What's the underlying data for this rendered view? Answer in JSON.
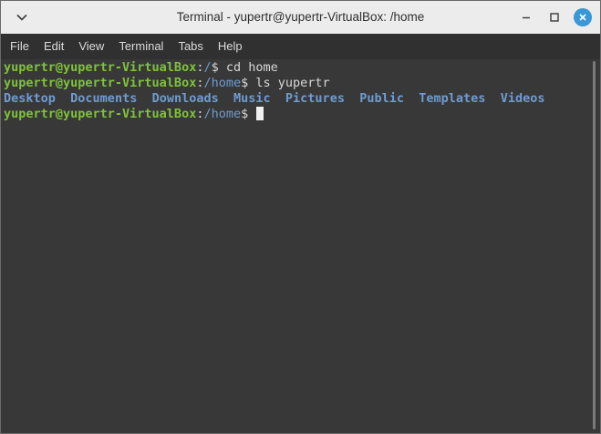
{
  "window": {
    "title": "Terminal - yupertr@yupertr-VirtualBox: /home"
  },
  "menubar": {
    "items": [
      "File",
      "Edit",
      "View",
      "Terminal",
      "Tabs",
      "Help"
    ]
  },
  "terminal": {
    "lines": [
      {
        "user": "yupertr@yupertr-VirtualBox",
        "sep": ":",
        "path": "/",
        "prompt": "$ ",
        "command": "cd home"
      },
      {
        "user": "yupertr@yupertr-VirtualBox",
        "sep": ":",
        "path": "/home",
        "prompt": "$ ",
        "command": "ls yupertr"
      },
      {
        "entries": [
          "Desktop",
          "Documents",
          "Downloads",
          "Music",
          "Pictures",
          "Public",
          "Templates",
          "Videos"
        ]
      },
      {
        "user": "yupertr@yupertr-VirtualBox",
        "sep": ":",
        "path": "/home",
        "prompt": "$ ",
        "command": ""
      }
    ]
  },
  "colors": {
    "user": "#7fc33a",
    "path": "#6f9ccf",
    "background": "#383838",
    "close_button": "#3a97d5"
  },
  "icons": {
    "window_menu": "chevron-down-icon",
    "minimize": "minimize-icon",
    "maximize": "maximize-icon",
    "close": "close-icon"
  }
}
